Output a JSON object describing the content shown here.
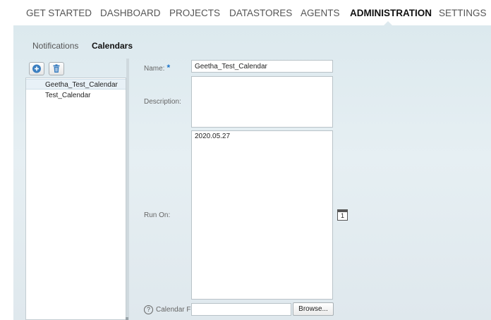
{
  "topnav": {
    "items": [
      {
        "label": "GET STARTED"
      },
      {
        "label": "DASHBOARD"
      },
      {
        "label": "PROJECTS"
      },
      {
        "label": "DATASTORES"
      },
      {
        "label": "AGENTS"
      },
      {
        "label": "ADMINISTRATION",
        "active": true
      },
      {
        "label": "SETTINGS"
      }
    ]
  },
  "subtabs": [
    {
      "label": "Notifications"
    },
    {
      "label": "Calendars",
      "active": true
    }
  ],
  "left_panel": {
    "toolbar": {
      "add_icon": "plus-circle-icon",
      "delete_icon": "trash-icon"
    },
    "calendars": [
      {
        "name": "Geetha_Test_Calendar",
        "selected": true
      },
      {
        "name": "Test_Calendar",
        "selected": false
      }
    ]
  },
  "form": {
    "name_label": "Name:",
    "required_marker": "*",
    "name_value": "Geetha_Test_Calendar",
    "description_label": "Description:",
    "description_value": "",
    "run_on_label": "Run On:",
    "run_on_value": "2020.05.27",
    "calendar_file_label": "Calendar F",
    "calendar_file_value": "",
    "browse_label": "Browse...",
    "help_glyph": "?",
    "calendar_icon_glyph": "1"
  },
  "colors": {
    "accent": "#1a73c9",
    "background": "#dce9ee"
  }
}
